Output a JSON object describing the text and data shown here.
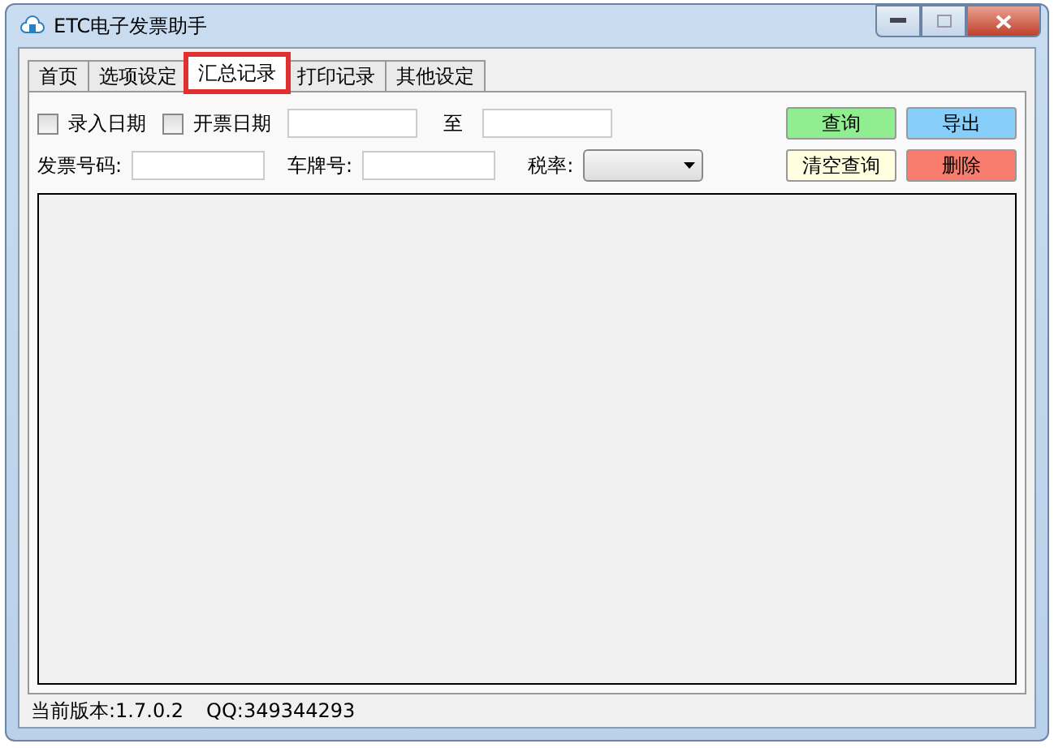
{
  "window": {
    "title": "ETC电子发票助手"
  },
  "tabs": [
    {
      "label": "首页",
      "selected": false
    },
    {
      "label": "选项设定",
      "selected": false
    },
    {
      "label": "汇总记录",
      "selected": true
    },
    {
      "label": "打印记录",
      "selected": false
    },
    {
      "label": "其他设定",
      "selected": false
    }
  ],
  "filters": {
    "entry_date": {
      "label": "录入日期",
      "checked": false
    },
    "invoice_date": {
      "label": "开票日期",
      "checked": false
    },
    "to_label": "至",
    "invoice_no_label": "发票号码:",
    "plate_label": "车牌号:",
    "tax_rate_label": "税率:"
  },
  "buttons": [
    {
      "label": "查询",
      "color": "#90ee90"
    },
    {
      "label": "导出",
      "color": "#87cefa"
    },
    {
      "label": "清空查询",
      "color": "#ffffe0"
    },
    {
      "label": "删除",
      "color": "#f87d6e"
    }
  ],
  "status_bar": {
    "version": "当前版本:1.7.0.2",
    "qq": "QQ:349344293"
  }
}
